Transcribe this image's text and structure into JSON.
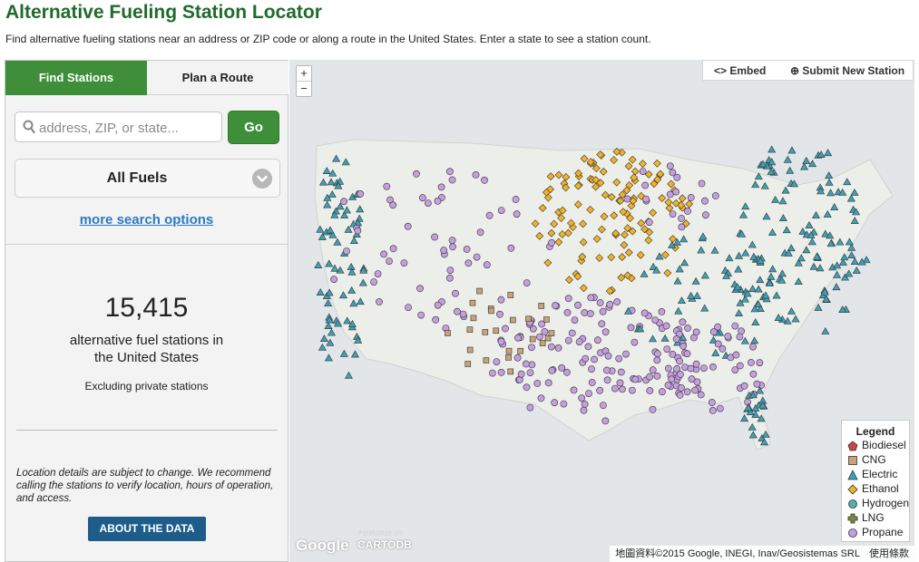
{
  "header": {
    "title": "Alternative Fueling Station Locator",
    "subtitle": "Find alternative fueling stations near an address or ZIP code or along a route in the United States. Enter a state to see a station count."
  },
  "panel": {
    "tabs": [
      {
        "label": "Find Stations",
        "active": true
      },
      {
        "label": "Plan a Route",
        "active": false
      }
    ],
    "search": {
      "placeholder": "address, ZIP, or state...",
      "value": ""
    },
    "go_label": "Go",
    "fuel_select": {
      "selected": "All Fuels"
    },
    "more_options": "more search options",
    "count": "15,415",
    "count_label": "alternative fuel stations in the United States",
    "excluding": "Excluding private stations",
    "disclaimer": "Location details are subject to change. We recommend calling the stations to verify location, hours of operation, and access.",
    "about_label": "ABOUT THE DATA"
  },
  "map": {
    "zoom_in": "+",
    "zoom_out": "−",
    "embed_label": "Embed",
    "submit_label": "Submit New Station",
    "legend": {
      "title": "Legend",
      "items": [
        {
          "label": "Biodiesel",
          "color": "#c8464b",
          "icon": "pentagon-icon"
        },
        {
          "label": "CNG",
          "color": "#c8a27a",
          "icon": "square-icon"
        },
        {
          "label": "Electric",
          "color": "#3f9fb4",
          "icon": "triangle-icon"
        },
        {
          "label": "Ethanol",
          "color": "#f2b227",
          "icon": "diamond-icon"
        },
        {
          "label": "Hydrogen",
          "color": "#4fb0b0",
          "icon": "circle-icon"
        },
        {
          "label": "LNG",
          "color": "#7f8a3a",
          "icon": "plus-icon"
        },
        {
          "label": "Propane",
          "color": "#c59ee0",
          "icon": "circle-icon"
        }
      ]
    },
    "google": "Google",
    "powered_by": "POWERED BY",
    "cartodb": "CARTODB",
    "attribution": "地圖資料©2015 Google, INEGI, Inav/Geosistemas SRL",
    "terms": "使用條款"
  },
  "colors": {
    "brand_green": "#3e8e3a",
    "title_green": "#1f6b2a",
    "link_blue": "#2b7bbf",
    "about_button": "#1e5d8a"
  }
}
